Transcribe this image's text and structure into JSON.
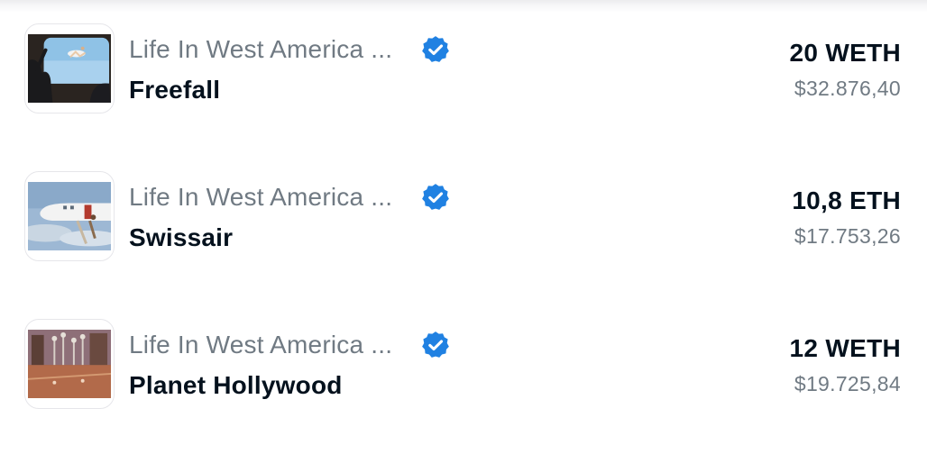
{
  "listings": [
    {
      "collection": "Life In West America ...",
      "name": "Freefall",
      "price": "20 WETH",
      "usd": "$32.876,40",
      "verified_icon": "verified-badge-icon"
    },
    {
      "collection": "Life In West America ...",
      "name": "Swissair",
      "price": "10,8 ETH",
      "usd": "$17.753,26",
      "verified_icon": "verified-badge-icon"
    },
    {
      "collection": "Life In West America ...",
      "name": "Planet Hollywood",
      "price": "12 WETH",
      "usd": "$19.725,84",
      "verified_icon": "verified-badge-icon"
    }
  ],
  "colors": {
    "verified": "#2081e2",
    "primary_text": "#04111d",
    "secondary_text": "#707a83"
  }
}
